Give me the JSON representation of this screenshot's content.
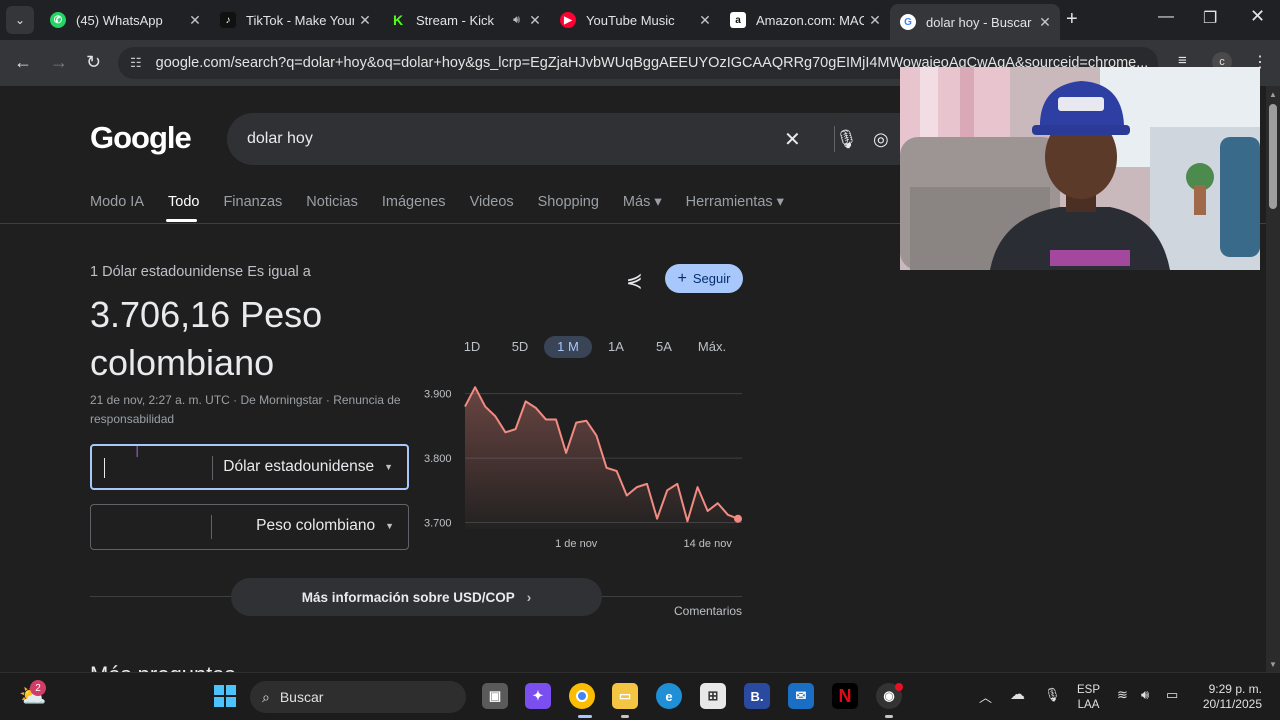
{
  "tabs": [
    {
      "title": "(45) WhatsApp",
      "icon": "whatsapp-icon",
      "color": "#25d366"
    },
    {
      "title": "TikTok - Make Your",
      "icon": "tiktok-icon",
      "color": "#000000"
    },
    {
      "title": "Stream - Kick",
      "icon": "kick-icon",
      "color": "#53fc18"
    },
    {
      "title": "YouTube Music",
      "icon": "youtube-music-icon",
      "color": "#ff0033"
    },
    {
      "title": "Amazon.com: MAC",
      "icon": "amazon-icon",
      "color": "#ffffff"
    },
    {
      "title": "dolar hoy - Buscar",
      "icon": "google-icon",
      "color": "#ffffff"
    }
  ],
  "url": "google.com/search?q=dolar+hoy&oq=dolar+hoy&gs_lcrp=EgZjaHJvbWUqBggAEEUYOzIGCAAQRRg70gEIMjI4MWowajeoAgCwAgA&sourceid=chrome...",
  "google": {
    "logo": "Google",
    "query": "dolar hoy",
    "nav_tabs": [
      "Modo IA",
      "Todo",
      "Finanzas",
      "Noticias",
      "Imágenes",
      "Videos",
      "Shopping",
      "Más ▾"
    ],
    "tools": "Herramientas ▾"
  },
  "converter": {
    "label": "1 Dólar estadounidense Es igual a",
    "value": "3.706,16 Peso colombiano",
    "meta": "21 de nov, 2:27 a. m. UTC · De Morningstar · Renuncia de responsabilidad",
    "follow": "Seguir",
    "ranges": [
      "1D",
      "5D",
      "1 M",
      "1A",
      "5A",
      "Máx."
    ],
    "selected_range": "1 M",
    "from_unit": "Dólar estadounidense",
    "to_unit": "Peso colombiano",
    "more_info": "Más información sobre USD/COP",
    "feedback": "Comentarios"
  },
  "chart_data": {
    "type": "area",
    "title": "",
    "xlabel": "",
    "ylabel": "",
    "ylim": [
      3690,
      3915
    ],
    "yticks": [
      3900,
      3800,
      3700
    ],
    "ytick_labels": [
      "3.900",
      "3.800",
      "3.700"
    ],
    "xtick_labels": [
      {
        "label": "1 de nov",
        "index": 11
      },
      {
        "label": "14 de nov",
        "index": 24
      }
    ],
    "values": [
      3880,
      3910,
      3880,
      3865,
      3840,
      3845,
      3888,
      3878,
      3860,
      3860,
      3808,
      3855,
      3858,
      3835,
      3785,
      3780,
      3742,
      3755,
      3760,
      3706,
      3750,
      3760,
      3702,
      3755,
      3718,
      3730,
      3712,
      3706
    ],
    "color": "#f28b82"
  },
  "peek_heading": "Más preguntas",
  "taskbar": {
    "search": "Buscar",
    "widget_badge": "2",
    "lang_line1": "ESP",
    "lang_line2": "LAA",
    "time": "9:29 p. m.",
    "date": "20/11/2025"
  }
}
